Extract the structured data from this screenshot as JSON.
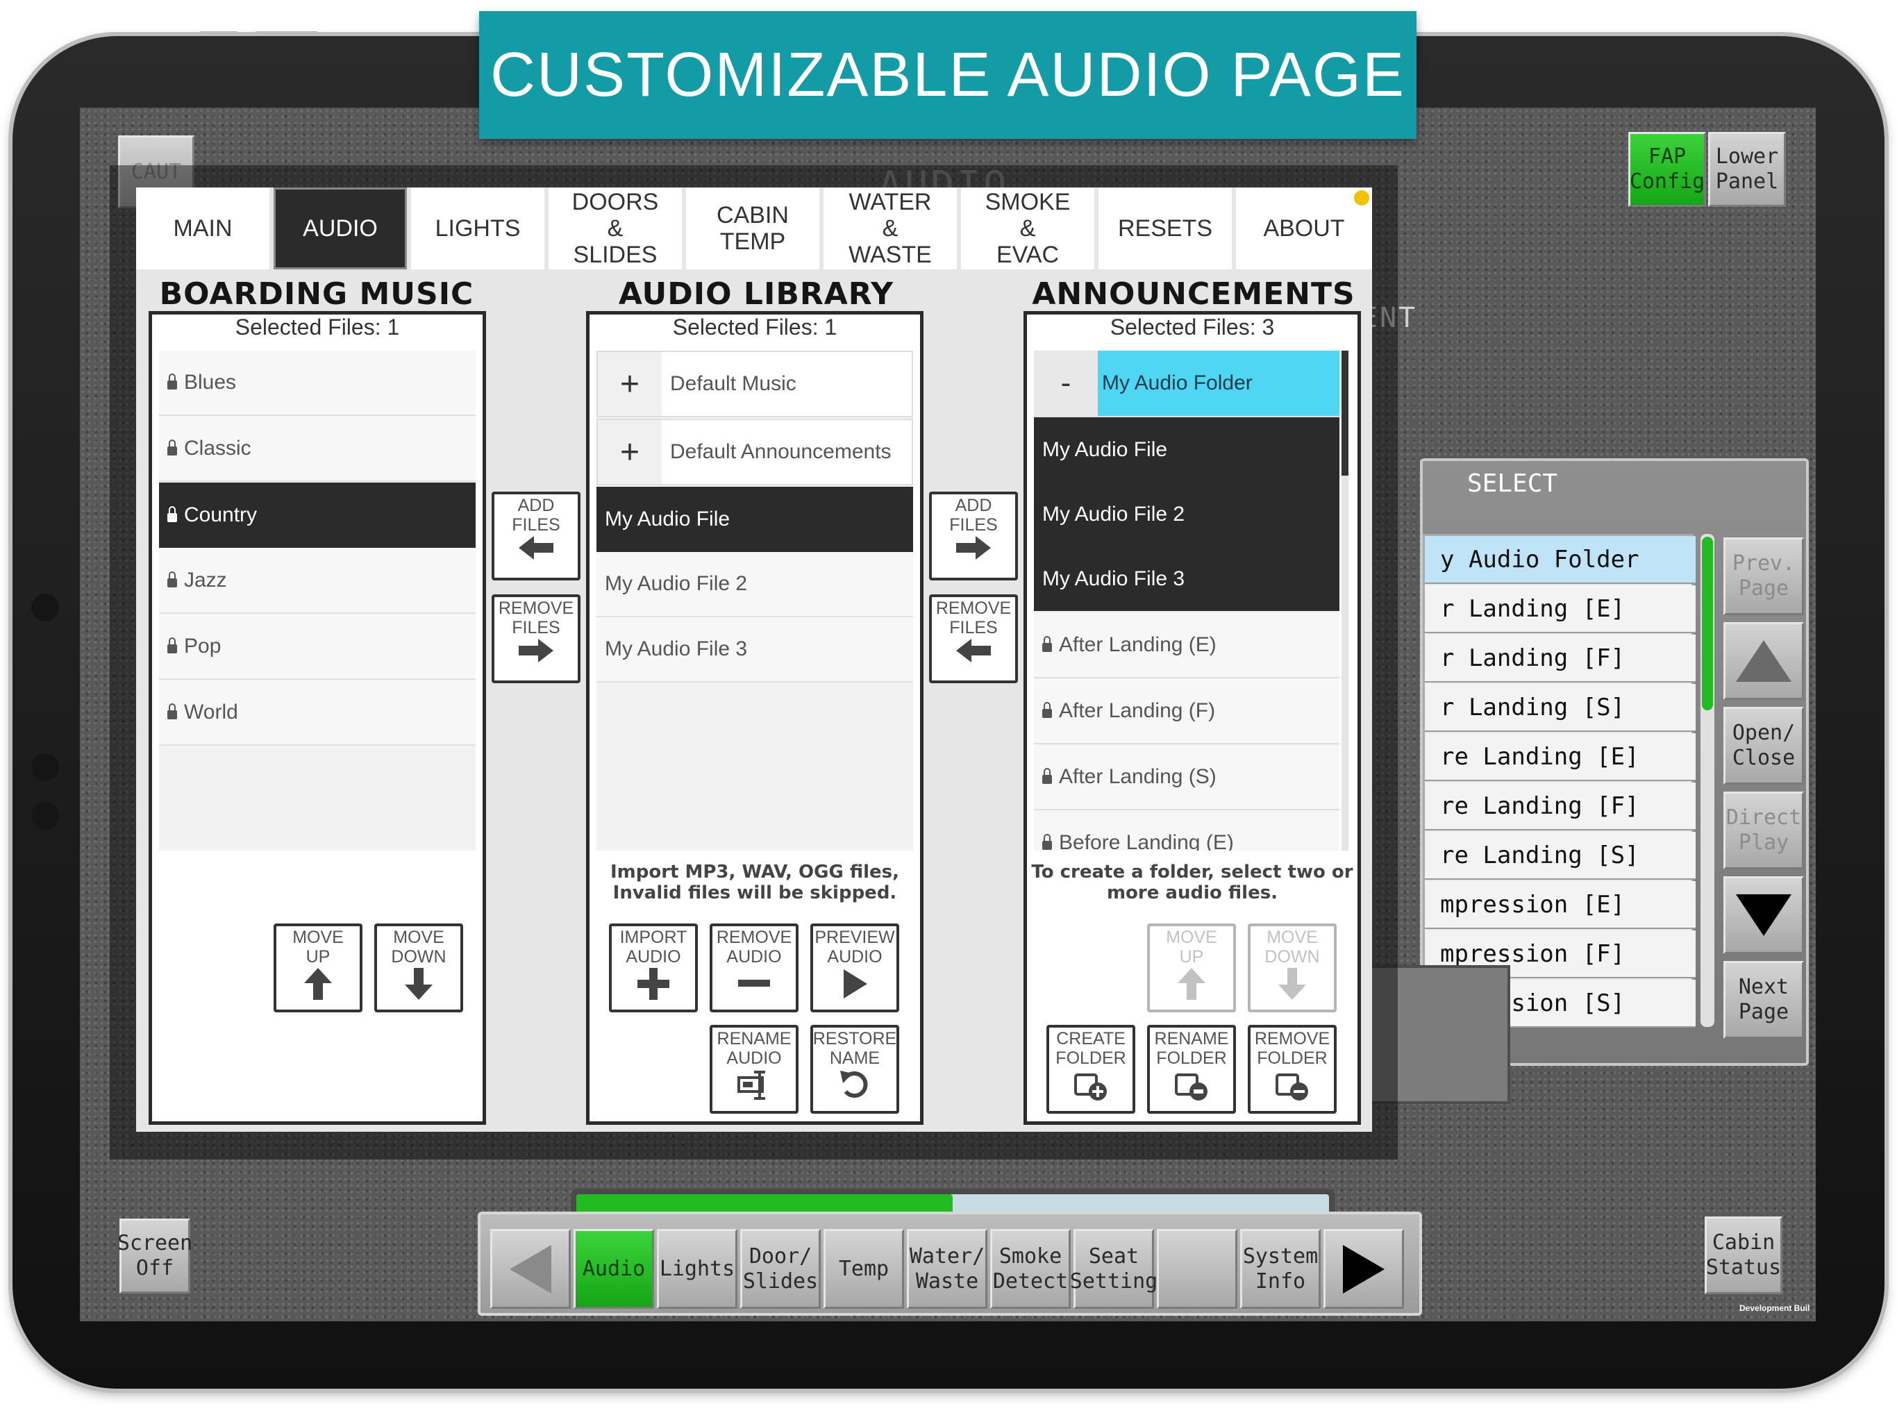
{
  "banner": {
    "title": "CUSTOMIZABLE AUDIO PAGE"
  },
  "background": {
    "caut_label": "CAUT",
    "page_title_behind": "AUDIO",
    "top_right": {
      "fap_config": "FAP\nConfig",
      "lower_panel": "Lower\nPanel"
    },
    "select_panel": {
      "heading_fragment": "ENT",
      "title": "SELECT",
      "items": [
        "y Audio Folder",
        "r Landing [E]",
        "r Landing [F]",
        "r Landing [S]",
        "re Landing [E]",
        "re Landing [F]",
        "re Landing [S]",
        "mpression [E]",
        "mpression [F]",
        "mpression [S]"
      ],
      "buttons": {
        "prev_page": "Prev.\nPage",
        "open_close": "Open/\nClose",
        "direct_play": "Direct\nPlay",
        "next_page": "Next\nPage"
      }
    },
    "screen_off": "Screen\nOff",
    "cabin_status": "Cabin\nStatus",
    "dev_build": "Development Buil",
    "progress_fraction": 0.5
  },
  "tabs": [
    {
      "label": "MAIN"
    },
    {
      "label": "AUDIO"
    },
    {
      "label": "LIGHTS"
    },
    {
      "label": "DOORS\n&\nSLIDES"
    },
    {
      "label": "CABIN\nTEMP"
    },
    {
      "label": "WATER\n&\nWASTE"
    },
    {
      "label": "SMOKE\n&\nEVAC"
    },
    {
      "label": "RESETS"
    },
    {
      "label": "ABOUT"
    }
  ],
  "boarding_music": {
    "title": "BOARDING MUSIC",
    "selected": "Selected Files: 1",
    "items": [
      "Blues",
      "Classic",
      "Country",
      "Jazz",
      "Pop",
      "World"
    ],
    "move_up": "MOVE\nUP",
    "move_down": "MOVE\nDOWN"
  },
  "transfer_left": {
    "add": "ADD\nFILES",
    "remove": "REMOVE\nFILES"
  },
  "audio_library": {
    "title": "AUDIO LIBRARY",
    "selected": "Selected Files: 1",
    "folders": [
      "Default Music",
      "Default Announcements"
    ],
    "items": [
      "My Audio File",
      "My Audio File 2",
      "My Audio File 3"
    ],
    "note": "Import MP3, WAV, OGG files,\nInvalid files will be skipped.",
    "import": "IMPORT\nAUDIO",
    "remove": "REMOVE\nAUDIO",
    "preview": "PREVIEW\nAUDIO",
    "rename": "RENAME\nAUDIO",
    "restore": "RESTORE\nNAME"
  },
  "transfer_right": {
    "add": "ADD\nFILES",
    "remove": "REMOVE\nFILES"
  },
  "announcements": {
    "title": "ANNOUNCEMENTS",
    "selected": "Selected Files: 3",
    "folder": "My Audio Folder",
    "folder_items": [
      "My Audio File",
      "My Audio File 2",
      "My Audio File 3"
    ],
    "items": [
      "After Landing (E)",
      "After Landing (F)",
      "After Landing (S)",
      "Before Landing (E)"
    ],
    "note": "To create a folder, select two or\nmore audio files.",
    "move_up": "MOVE\nUP",
    "move_down": "MOVE\nDOWN",
    "create_folder": "CREATE\nFOLDER",
    "rename_folder": "RENAME\nFOLDER",
    "remove_folder": "REMOVE\nFOLDER"
  },
  "bottom_nav": [
    "Audio",
    "Lights",
    "Door/\nSlides",
    "Temp",
    "Water/\nWaste",
    "Smoke\nDetect",
    "Seat\nSetting",
    "",
    "System\nInfo"
  ],
  "colors": {
    "banner": "#139ba6",
    "active_green": "#22bb22",
    "folder_cyan": "#4fd6f2",
    "tab_dot": "#f2c200"
  }
}
